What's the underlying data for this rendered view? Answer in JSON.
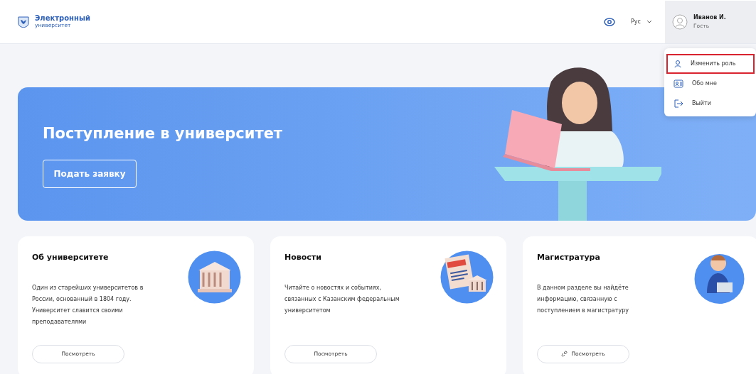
{
  "header": {
    "logo": {
      "title": "Электронный",
      "subtitle": "университет"
    },
    "language": "Рус",
    "user": {
      "name": "Иванов И.",
      "role": "Гость"
    }
  },
  "user_menu": {
    "open": true,
    "items": [
      {
        "kind": "role",
        "label": "Изменить роль",
        "highlighted": true
      },
      {
        "kind": "profile",
        "label": "Обо мне",
        "highlighted": false
      },
      {
        "kind": "logout",
        "label": "Выйти",
        "highlighted": false
      }
    ]
  },
  "banner": {
    "title": "Поступление в университет",
    "button": "Подать заявку"
  },
  "cards": [
    {
      "kind": "building",
      "title": "Об университете",
      "text": "Один из старейших университетов в России, основанный в 1804 году. Университет славится своими преподавателями",
      "button": "Посмотреть",
      "button_icon": false
    },
    {
      "kind": "news",
      "title": "Новости",
      "text": "Читайте о новостях и событиях, связанных с Казанским федеральным университетом",
      "button": "Посмотреть",
      "button_icon": false
    },
    {
      "kind": "person",
      "title": "Магистратура",
      "text": "В данном разделе вы найдёте информацию, связанную с поступлением в магистратуру",
      "button": "Посмотреть",
      "button_icon": true
    }
  ]
}
